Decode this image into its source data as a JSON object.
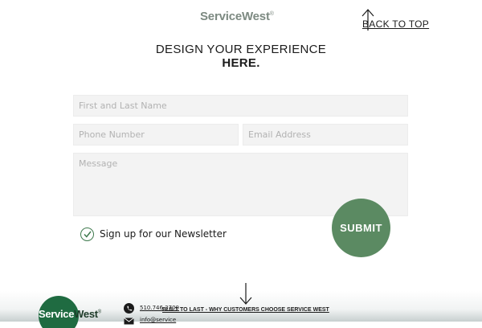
{
  "header": {
    "logo_text": "ServiceWest",
    "logo_reg": "®",
    "back_to_top_label": "BACK TO TOP"
  },
  "form": {
    "heading_line1": "DESIGN YOUR EXPERIENCE",
    "heading_line2": "HERE.",
    "name_placeholder": "First and Last Name",
    "phone_placeholder": "Phone Number",
    "email_placeholder": "Email Address",
    "message_placeholder": "Message",
    "newsletter_label": "Sign up for our Newsletter",
    "newsletter_checked": true,
    "submit_label": "SUBMIT"
  },
  "footer": {
    "logo_text_white": "Service",
    "logo_text_dark": "West",
    "logo_reg": "®",
    "phone_text": "510.746.3700",
    "email_text": "info@service",
    "built_link": "BUILT TO LAST - WHY CUSTOMERS CHOOSE SERVICE WEST"
  },
  "colors": {
    "accent_green": "#5b8a62",
    "logo_green": "#1f6b41",
    "field_bg": "#f3f3f3"
  },
  "icons": {
    "back_to_top": "arrow-up-icon",
    "check": "check-circle-icon",
    "phone": "phone-icon",
    "mail": "mail-icon",
    "scroll_down": "arrow-down-icon"
  }
}
